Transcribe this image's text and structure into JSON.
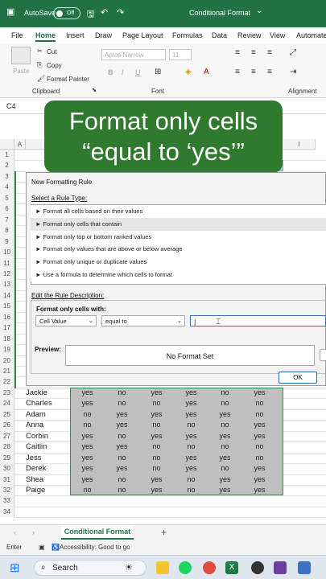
{
  "titlebar": {
    "autosave": "AutoSave",
    "toggle": "Off",
    "filename": "Conditional Format"
  },
  "menu": [
    "File",
    "Home",
    "Insert",
    "Draw",
    "Page Layout",
    "Formulas",
    "Data",
    "Review",
    "View",
    "Automate"
  ],
  "ribbon": {
    "paste": "Paste",
    "cut": "Cut",
    "copy": "Copy",
    "format_painter": "Format Painter",
    "clipboard": "Clipboard",
    "font_name": "Aptos Narrow",
    "font_size": "11",
    "font": "Font",
    "alignment": "Alignment",
    "bold": "B",
    "italic": "I",
    "underline": "U"
  },
  "formula_bar": {
    "name_box": "C4"
  },
  "overlay": {
    "line1": "Format only cells",
    "line2": "“equal to ‘yes’”"
  },
  "columns": [
    "A",
    "B",
    "I"
  ],
  "rows": [
    "1",
    "2",
    "3",
    "4",
    "5",
    "6",
    "7",
    "8",
    "9",
    "10",
    "11",
    "12",
    "13",
    "14",
    "15",
    "16",
    "17",
    "18",
    "19",
    "20",
    "21",
    "22",
    "23",
    "24",
    "25",
    "26",
    "27",
    "28",
    "29",
    "30",
    "31",
    "32",
    "33",
    "34"
  ],
  "dialog": {
    "title": "New Formatting Rule",
    "select_label": "Select a Rule Type:",
    "rule_types": [
      "Format all cells based on their values",
      "Format only cells that contain",
      "Format only top or bottom ranked values",
      "Format only values that are above or below average",
      "Format only unique or duplicate values",
      "Use a formula to determine which cells to format"
    ],
    "edit_label": "Edit the Rule Description:",
    "format_only_label": "Format only cells with:",
    "cell_value": "Cell Value",
    "operator": "equal to",
    "preview_label": "Preview:",
    "preview_text": "No Format Set",
    "ok": "OK"
  },
  "table": {
    "rows": [
      {
        "name": "Jackie",
        "values": [
          "yes",
          "no",
          "yes",
          "yes",
          "no",
          "yes"
        ]
      },
      {
        "name": "Charles",
        "values": [
          "yes",
          "no",
          "no",
          "yes",
          "no",
          "no"
        ]
      },
      {
        "name": "Adam",
        "values": [
          "no",
          "yes",
          "yes",
          "yes",
          "yes",
          "no"
        ]
      },
      {
        "name": "Anna",
        "values": [
          "no",
          "yes",
          "no",
          "no",
          "no",
          "yes"
        ]
      },
      {
        "name": "Corbin",
        "values": [
          "yes",
          "no",
          "yes",
          "yes",
          "yes",
          "yes"
        ]
      },
      {
        "name": "Caitlin",
        "values": [
          "yes",
          "yes",
          "no",
          "no",
          "no",
          "no"
        ]
      },
      {
        "name": "Jess",
        "values": [
          "yes",
          "no",
          "no",
          "yes",
          "yes",
          "no"
        ]
      },
      {
        "name": "Derek",
        "values": [
          "yes",
          "yes",
          "no",
          "yes",
          "no",
          "yes"
        ]
      },
      {
        "name": "Shea",
        "values": [
          "yes",
          "no",
          "yes",
          "no",
          "yes",
          "yes"
        ]
      },
      {
        "name": "Paige",
        "values": [
          "no",
          "no",
          "yes",
          "no",
          "yes",
          "yes"
        ]
      }
    ]
  },
  "sheet_tab": "Conditional Format",
  "status": {
    "mode": "Enter",
    "accessibility": "Accessibility: Good to go"
  },
  "taskbar": {
    "search": "Search"
  }
}
